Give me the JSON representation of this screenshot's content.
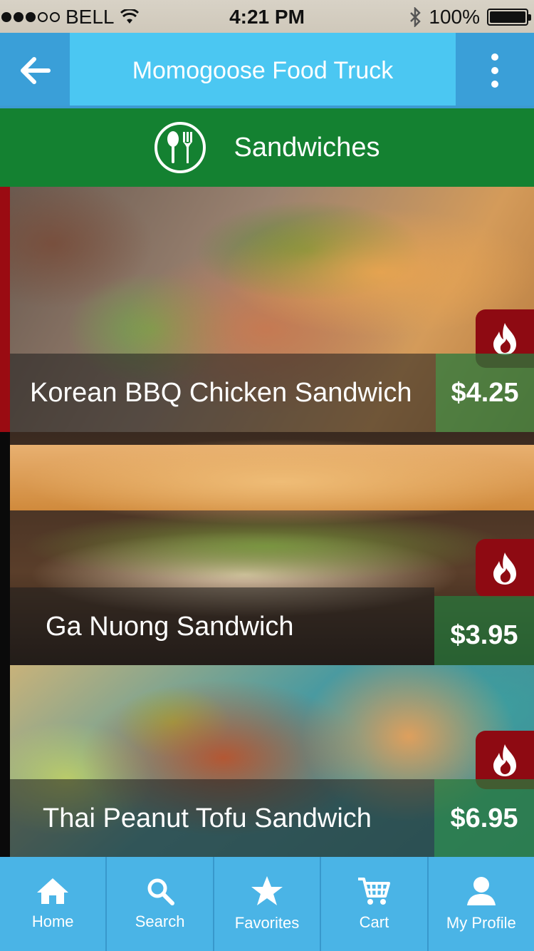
{
  "status_bar": {
    "carrier": "BELL",
    "time": "4:21 PM",
    "battery": "100%",
    "signal_bars_filled": 3,
    "signal_bars_total": 5
  },
  "header": {
    "title": "Momogoose Food Truck",
    "back_icon": "arrow-left-icon",
    "menu_icon": "more-vertical-icon"
  },
  "category": {
    "title": "Sandwiches",
    "icon": "utensils-icon"
  },
  "items": [
    {
      "name": "Korean BBQ Chicken Sandwich",
      "price": "$4.25",
      "spicy": true
    },
    {
      "name": "Ga Nuong Sandwich",
      "price": "$3.95",
      "spicy": true
    },
    {
      "name": "Thai Peanut Tofu Sandwich",
      "price": "$6.95",
      "spicy": true
    }
  ],
  "tabs": [
    {
      "label": "Home",
      "icon": "home-icon"
    },
    {
      "label": "Search",
      "icon": "search-icon"
    },
    {
      "label": "Favorites",
      "icon": "star-icon"
    },
    {
      "label": "Cart",
      "icon": "cart-icon"
    },
    {
      "label": "My Profile",
      "icon": "user-icon"
    }
  ],
  "colors": {
    "header_bg": "#4bc7f2",
    "header_button_bg": "#3a9fd8",
    "category_bg": "#148131",
    "spicy_badge": "#8e0a12",
    "tab_bar_bg": "#4ab4e6"
  }
}
